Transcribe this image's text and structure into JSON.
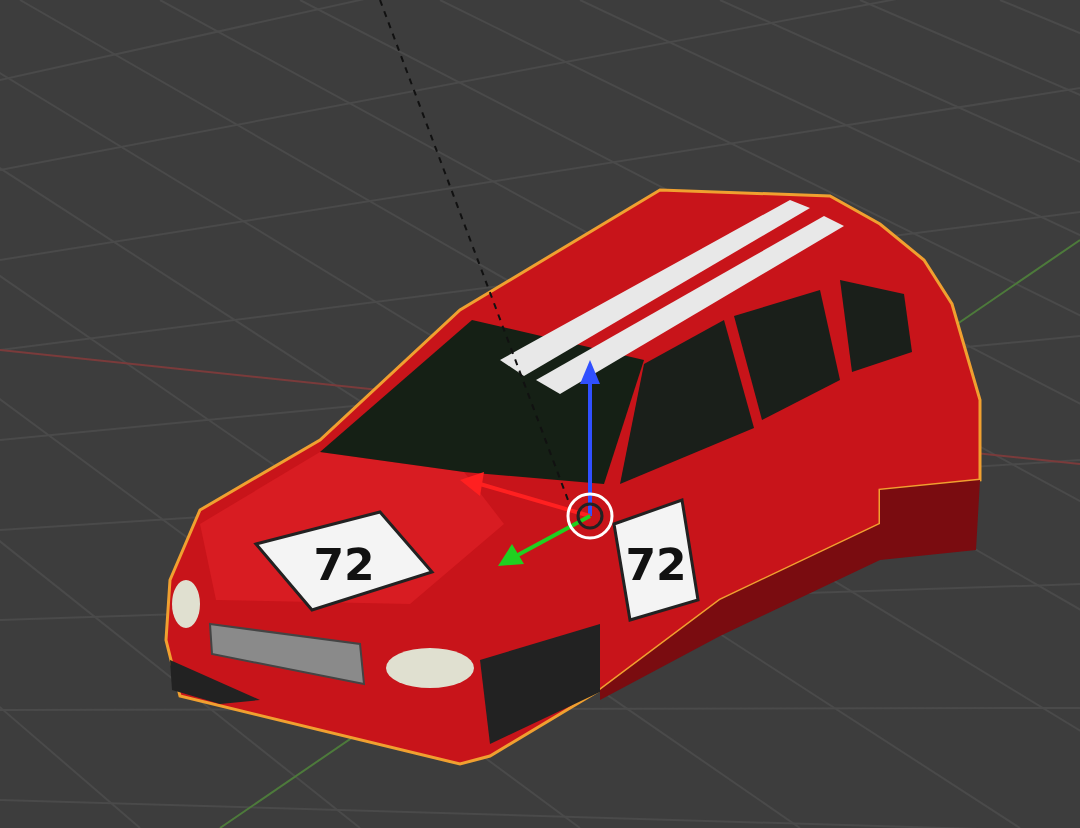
{
  "viewport": {
    "car_numbers": [
      "72",
      "72"
    ]
  }
}
